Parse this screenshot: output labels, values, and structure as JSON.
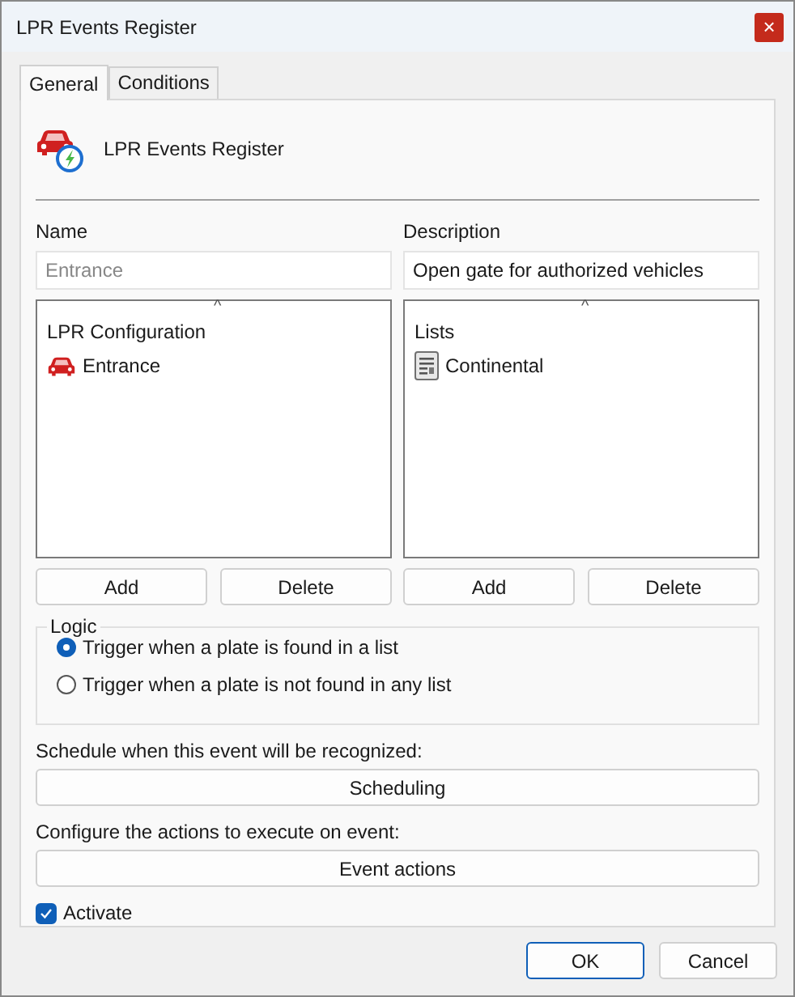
{
  "window": {
    "title": "LPR Events Register",
    "close": "×"
  },
  "tabs": [
    {
      "label": "General",
      "selected": true
    },
    {
      "label": "Conditions",
      "selected": false
    }
  ],
  "header": {
    "title": "LPR Events Register"
  },
  "name": {
    "label": "Name",
    "placeholder": "Entrance"
  },
  "description": {
    "label": "Description",
    "value": "Open gate for authorized vehicles"
  },
  "lists": [
    {
      "column": "LPR Configuration",
      "sort": "^",
      "items": [
        {
          "label": "Entrance",
          "kind": "car"
        }
      ],
      "buttons": [
        "Add",
        "Delete"
      ]
    },
    {
      "column": "Lists",
      "sort": "^",
      "items": [
        {
          "label": "Continental",
          "kind": "list"
        }
      ],
      "buttons": [
        "Add",
        "Delete"
      ]
    }
  ],
  "logic": {
    "title": "Logic",
    "options": [
      {
        "label": "Trigger when a plate is found in a list",
        "selected": true
      },
      {
        "label": "Trigger when a plate is not found in any list",
        "selected": false
      }
    ]
  },
  "schedule": {
    "label": "Schedule when this event will be recognized:",
    "button": "Scheduling"
  },
  "actions": {
    "label": "Configure the actions to execute on event:",
    "button": "Event actions"
  },
  "activate": {
    "label": "Activate",
    "checked": true
  },
  "footer": {
    "buttons": [
      "OK",
      "Cancel"
    ]
  }
}
